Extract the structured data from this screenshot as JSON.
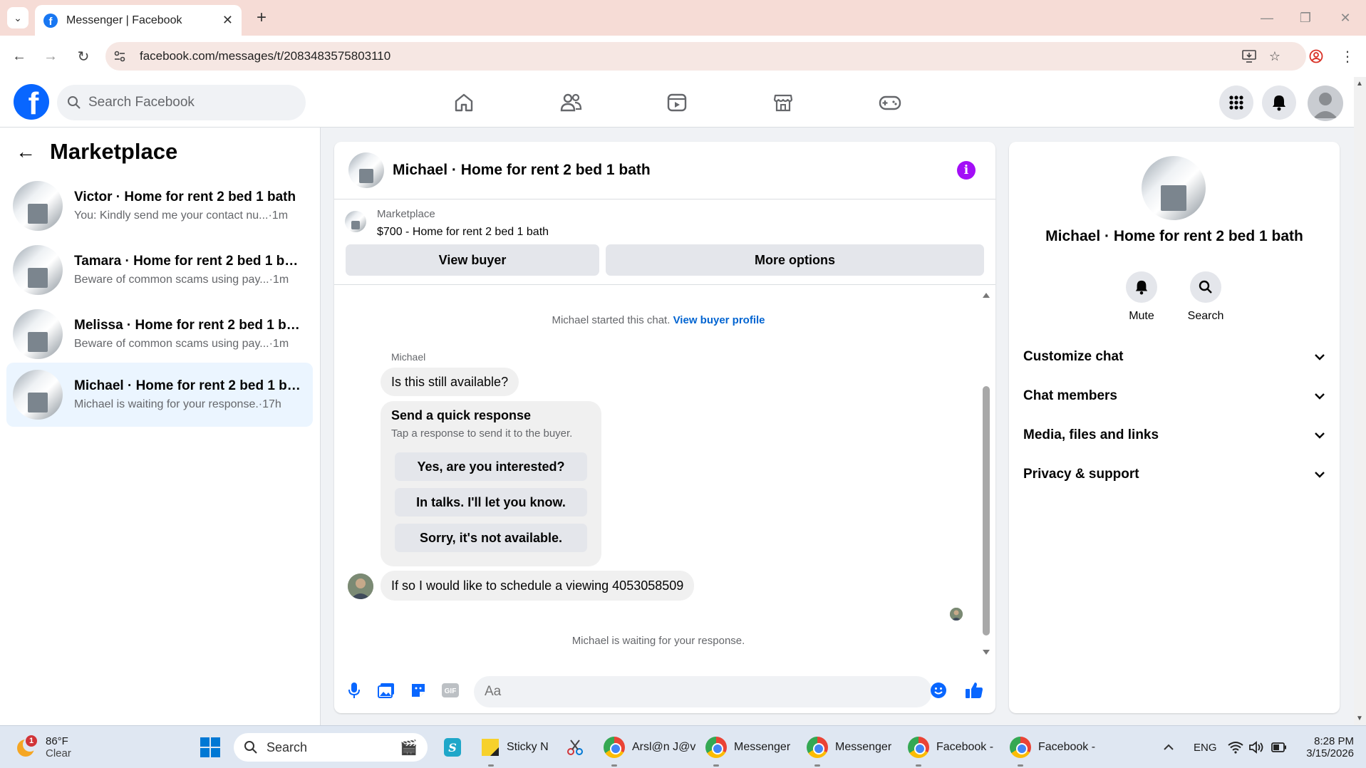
{
  "browser": {
    "tab_title": "Messenger | Facebook",
    "url": "facebook.com/messages/t/2083483575803110"
  },
  "fb": {
    "search_placeholder": "Search Facebook"
  },
  "sidebar": {
    "title": "Marketplace",
    "conversations": [
      {
        "title": "Victor · Home for rent 2 bed 1 bath",
        "snippet": "You: Kindly send me your contact nu...",
        "time": "·1m",
        "active": false
      },
      {
        "title": "Tamara · Home for rent 2 bed 1 bath",
        "snippet": "Beware of common scams using pay...",
        "time": "·1m",
        "active": false
      },
      {
        "title": "Melissa · Home for rent 2 bed 1 bath",
        "snippet": "Beware of common scams using pay...",
        "time": "·1m",
        "active": false
      },
      {
        "title": "Michael · Home for rent 2 bed 1 ba...",
        "snippet": "Michael is waiting for your response.",
        "time": "·17h",
        "active": true
      }
    ]
  },
  "chat": {
    "title": "Michael · Home for rent 2 bed 1 bath",
    "listing": {
      "label": "Marketplace",
      "price_title": "$700 - Home for rent 2 bed 1 bath",
      "view_buyer": "View buyer",
      "more_options": "More options"
    },
    "started_text": "Michael started this chat.",
    "view_profile_link": "View buyer profile",
    "sender_name": "Michael",
    "message_1": "Is this still available?",
    "quick_response": {
      "title": "Send a quick response",
      "subtitle": "Tap a response to send it to the buyer.",
      "options": [
        "Yes, are you interested?",
        "In talks. I'll let you know.",
        "Sorry, it's not available."
      ]
    },
    "message_2": "If so I would like to schedule a viewing  4053058509",
    "waiting_text": "Michael is waiting for your response.",
    "composer_placeholder": "Aa"
  },
  "info_panel": {
    "title": "Michael · Home for rent 2 bed 1 bath",
    "actions": [
      {
        "label": "Mute",
        "icon": "bell-icon"
      },
      {
        "label": "Search",
        "icon": "search-icon"
      }
    ],
    "sections": [
      "Customize chat",
      "Chat members",
      "Media, files and links",
      "Privacy & support"
    ]
  },
  "taskbar": {
    "weather_badge": "1",
    "temperature": "86°F",
    "condition": "Clear",
    "search_label": "Search",
    "apps": [
      {
        "label": "Sticky N"
      },
      {
        "label": "Arsl@n J@v"
      },
      {
        "label": "Messenger"
      },
      {
        "label": "Messenger"
      },
      {
        "label": "Facebook -"
      },
      {
        "label": "Facebook -"
      }
    ],
    "language": "ENG",
    "time": "8:28 PM",
    "date": "3/15/2026"
  },
  "colors": {
    "fb_blue": "#0866ff",
    "link_blue": "#0064d1",
    "info_purple": "#a30ef7",
    "active_conv": "#ebf5ff"
  }
}
